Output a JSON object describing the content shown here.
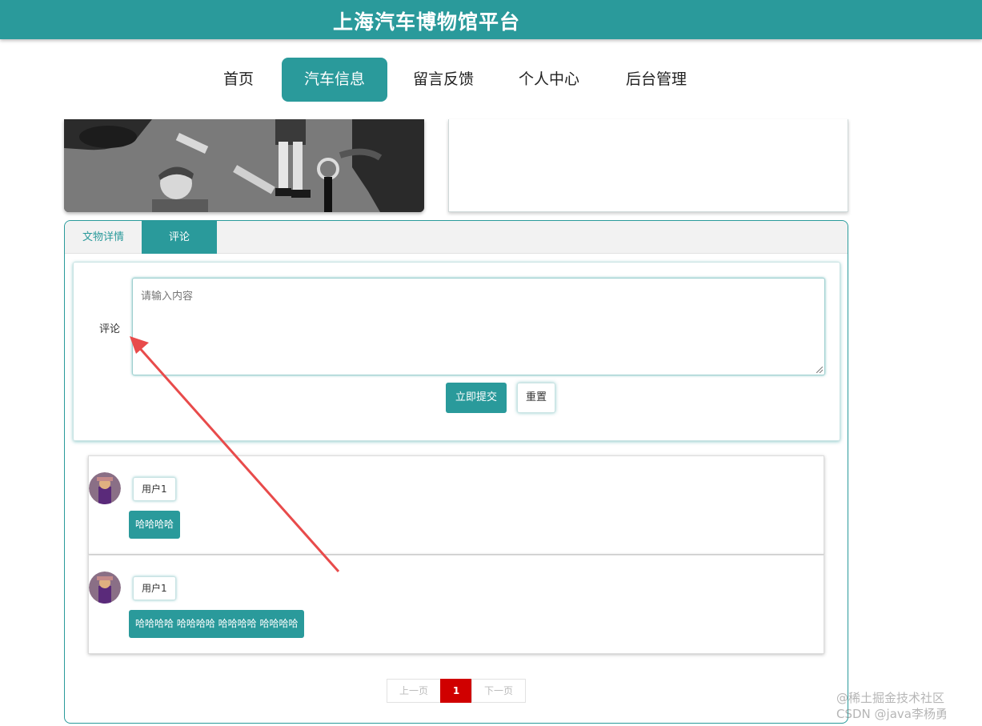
{
  "header": {
    "title": "上海汽车博物馆平台"
  },
  "nav": {
    "items": [
      {
        "label": "首页"
      },
      {
        "label": "汽车信息",
        "active": true
      },
      {
        "label": "留言反馈"
      },
      {
        "label": "个人中心"
      },
      {
        "label": "后台管理"
      }
    ]
  },
  "tabs": [
    {
      "label": "文物详情"
    },
    {
      "label": "评论",
      "active": true
    }
  ],
  "comment_form": {
    "label": "评论",
    "placeholder": "请输入内容",
    "submit_label": "立即提交",
    "reset_label": "重置"
  },
  "comments": [
    {
      "user": "用户1",
      "content": "哈哈哈哈"
    },
    {
      "user": "用户1",
      "content": "哈哈哈哈 哈哈哈哈 哈哈哈哈 哈哈哈哈"
    }
  ],
  "pagination": {
    "prev_label": "上一页",
    "current": "1",
    "next_label": "下一页"
  },
  "watermark": {
    "line1": "@稀土掘金技术社区",
    "line2": "CSDN @java李杨勇"
  },
  "colors": {
    "primary": "#2a9a9b",
    "pager_active": "#d00000",
    "annotation_arrow": "#e84b4b"
  }
}
